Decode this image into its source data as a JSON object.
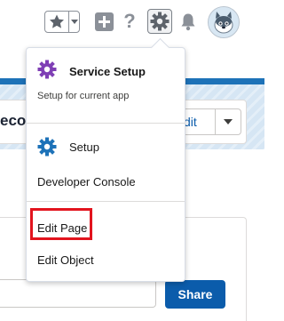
{
  "header": {
    "help_label": "?"
  },
  "record": {
    "title_partial": "ecor",
    "edit_label": "dit"
  },
  "actions": {
    "share_label": "Share"
  },
  "setup_menu": {
    "service_setup": {
      "label": "Service Setup",
      "sub_label": "Setup for current app"
    },
    "setup_label": "Setup",
    "developer_console_label": "Developer Console",
    "edit_page_label": "Edit Page",
    "edit_object_label": "Edit Object"
  },
  "colors": {
    "service_setup_icon": "#7f3fb5",
    "setup_icon": "#1d72b8",
    "highlight_box": "#e2141e",
    "share_button": "#0b5cab"
  }
}
